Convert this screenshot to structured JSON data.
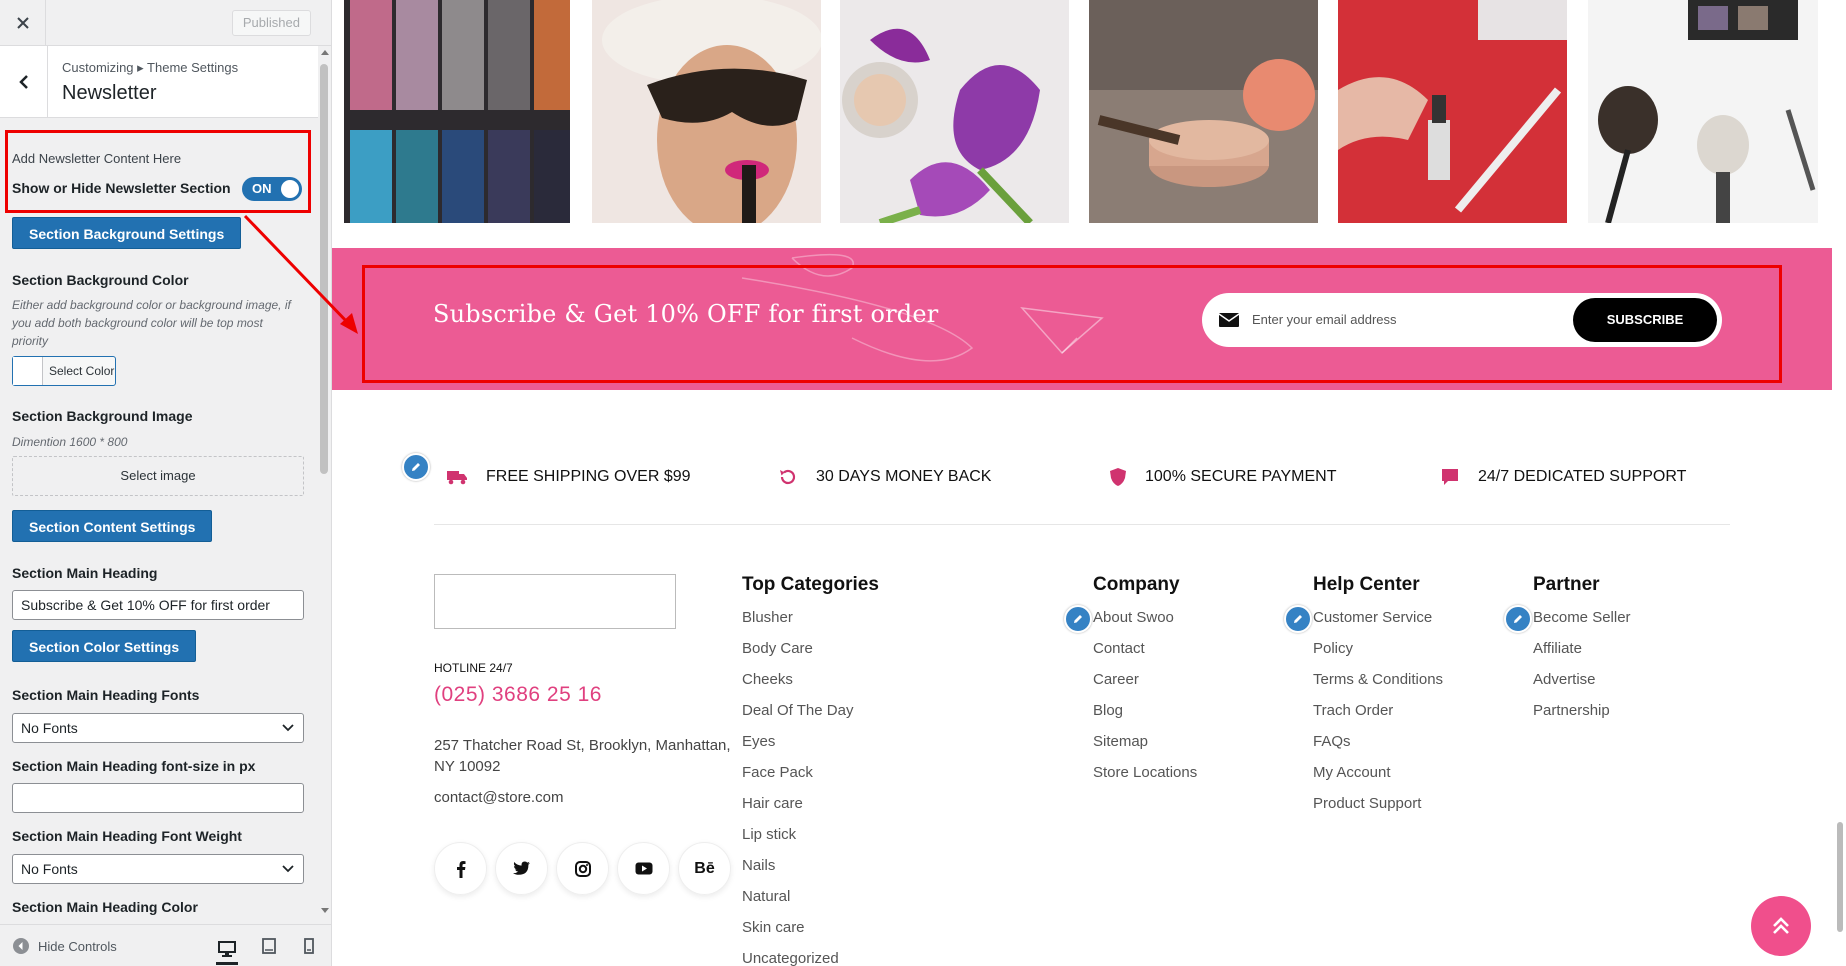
{
  "sidebar": {
    "close_icon": "close-icon",
    "publish_label": "Published",
    "breadcrumb": "Customizing ▸ Theme Settings",
    "section_title": "Newsletter",
    "intro": "Add Newsletter Content Here",
    "toggle_label": "Show or Hide Newsletter Section",
    "toggle_state": "ON",
    "bg_settings_btn": "Section Background Settings",
    "bg_color_label": "Section Background Color",
    "bg_color_desc": "Either add background color or background image, if you add both background color will be top most priority",
    "select_color_label": "Select Color",
    "bg_image_label": "Section Background Image",
    "bg_image_desc": "Dimention 1600 * 800",
    "select_image_label": "Select image",
    "content_settings_btn": "Section Content Settings",
    "main_heading_label": "Section Main Heading",
    "main_heading_value": "Subscribe & Get 10% OFF for first order",
    "color_settings_btn": "Section Color Settings",
    "heading_fonts_label": "Section Main Heading Fonts",
    "heading_fonts_value": "No Fonts",
    "font_size_label": "Section Main Heading font-size in px",
    "font_size_value": "",
    "font_weight_label": "Section Main Heading Font Weight",
    "font_weight_value": "No Fonts",
    "heading_color_label": "Section Main Heading Color",
    "hide_controls_label": "Hide Controls"
  },
  "gallery": {
    "images": [
      "eyeshadow-palette",
      "woman-lipstick",
      "tulips-compact",
      "cosmetic-jar-brush",
      "nail-polish-hands",
      "makeup-brushes"
    ]
  },
  "newsletter": {
    "heading": "Subscribe & Get 10% OFF for first order",
    "email_placeholder": "Enter your email address",
    "submit_label": "SUBSCRIBE",
    "bg_color": "#ec5b94"
  },
  "features": [
    {
      "icon": "truck-icon",
      "label": "FREE SHIPPING OVER $99"
    },
    {
      "icon": "refresh-icon",
      "label": "30 DAYS MONEY BACK"
    },
    {
      "icon": "shield-icon",
      "label": "100% SECURE PAYMENT"
    },
    {
      "icon": "chat-icon",
      "label": "24/7 DEDICATED SUPPORT"
    }
  ],
  "footer": {
    "hotline_label": "HOTLINE 24/7",
    "hotline_number": "(025) 3686 25 16",
    "address": "257 Thatcher Road St, Brooklyn, Manhattan, NY 10092",
    "email": "contact@store.com",
    "socials": [
      "facebook-icon",
      "twitter-icon",
      "instagram-icon",
      "youtube-icon",
      "behance-icon"
    ],
    "behance_text": "Bē",
    "columns": [
      {
        "title": "Top Categories",
        "links": [
          "Blusher",
          "Body Care",
          "Cheeks",
          "Deal Of The Day",
          "Eyes",
          "Face Pack",
          "Hair care",
          "Lip stick",
          "Nails",
          "Natural",
          "Skin care",
          "Uncategorized"
        ]
      },
      {
        "title": "Company",
        "links": [
          "About Swoo",
          "Contact",
          "Career",
          "Blog",
          "Sitemap",
          "Store Locations"
        ]
      },
      {
        "title": "Help Center",
        "links": [
          "Customer Service",
          "Policy",
          "Terms & Conditions",
          "Trach Order",
          "FAQs",
          "My Account",
          "Product Support"
        ]
      },
      {
        "title": "Partner",
        "links": [
          "Become Seller",
          "Affiliate",
          "Advertise",
          "Partnership"
        ]
      }
    ]
  },
  "colors": {
    "accent": "#2271b1",
    "pink": "#ec5b94",
    "highlight": "#e00000"
  }
}
